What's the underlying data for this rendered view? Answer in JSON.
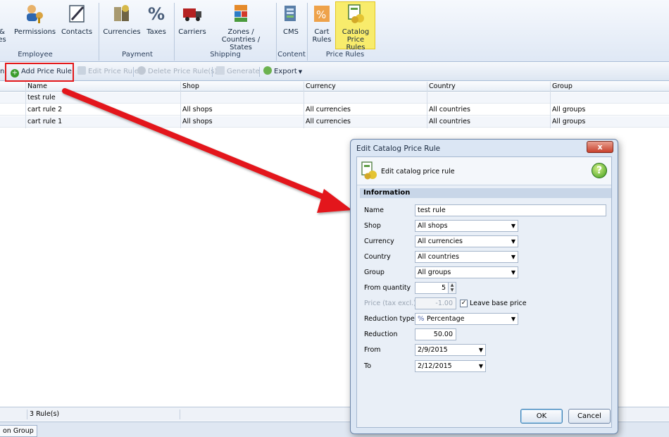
{
  "ribbon": {
    "items": [
      {
        "label": "&",
        "sub": "es"
      },
      {
        "label": "Permissions"
      },
      {
        "label": "Contacts"
      },
      {
        "label": "Currencies"
      },
      {
        "label": "Taxes"
      },
      {
        "label": "Carriers"
      },
      {
        "label": "Zones /",
        "sub": "Countries / States"
      },
      {
        "label": "CMS"
      },
      {
        "label": "Cart",
        "sub": "Rules"
      },
      {
        "label": "Catalog",
        "sub": "Price Rules"
      }
    ],
    "groups": [
      "Employee",
      "Payment",
      "Shipping",
      "Content",
      "Price Rules"
    ]
  },
  "toolbar": {
    "add": "Add Price Rule",
    "edit": "Edit Price Rule",
    "delete": "Delete Price Rule(s)",
    "generate": "Generate",
    "export": "Export"
  },
  "grid": {
    "columns": [
      "Name",
      "Shop",
      "Currency",
      "Country",
      "Group"
    ],
    "rows": [
      [
        "test rule",
        "",
        "",
        "",
        ""
      ],
      [
        "cart rule 2",
        "All shops",
        "All currencies",
        "All countries",
        "All groups"
      ],
      [
        "cart rule 1",
        "All shops",
        "All currencies",
        "All countries",
        "All groups"
      ]
    ],
    "footer_count": "3 Rule(s)"
  },
  "bottom_tab": "on Group",
  "dialog": {
    "title": "Edit Catalog Price Rule",
    "close": "x",
    "header": "Edit catalog price rule",
    "help": "?",
    "section": "Information",
    "fields": {
      "name_label": "Name",
      "name_value": "test rule",
      "shop_label": "Shop",
      "shop_value": "All shops",
      "currency_label": "Currency",
      "currency_value": "All currencies",
      "country_label": "Country",
      "country_value": "All countries",
      "group_label": "Group",
      "group_value": "All groups",
      "from_qty_label": "From quantity",
      "from_qty_value": "5",
      "price_label": "Price (tax excl.)",
      "price_value": "-1.00",
      "leave_base_label": "Leave base price",
      "red_type_label": "Reduction type",
      "red_type_value": "Percentage",
      "reduction_label": "Reduction",
      "reduction_value": "50.00",
      "from_label": "From",
      "from_value": "2/9/2015",
      "to_label": "To",
      "to_value": "2/12/2015"
    },
    "ok": "OK",
    "cancel": "Cancel"
  },
  "colors": {
    "highlight": "#f8ec6c",
    "annotation_red": "#e3181a"
  }
}
